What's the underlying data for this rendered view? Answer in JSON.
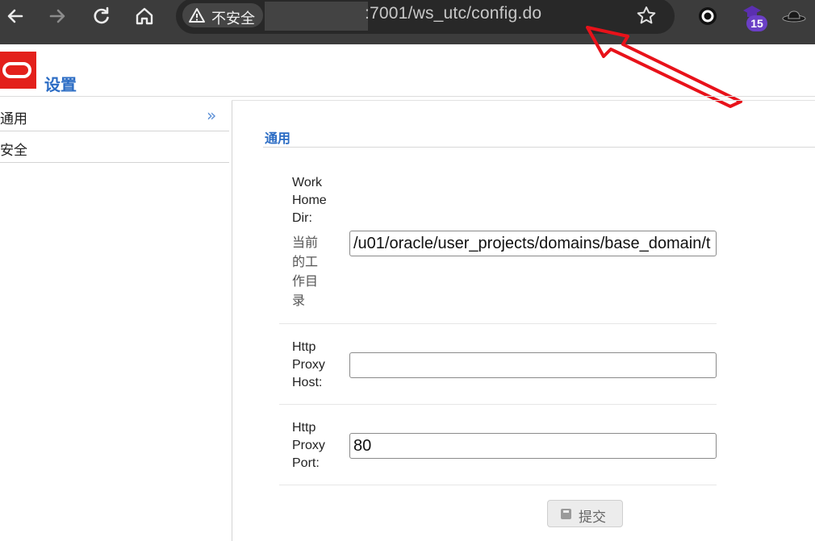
{
  "browser": {
    "security_label": "不安全",
    "url": ":7001/ws_utc/config.do",
    "extension_badge": "15"
  },
  "page": {
    "title": "设置"
  },
  "sidebar": {
    "items": [
      {
        "label": "通用",
        "active": true
      },
      {
        "label": "安全",
        "active": false
      }
    ]
  },
  "main": {
    "section_title": "通用",
    "fields": [
      {
        "label": "Work Home Dir:",
        "help": "当前的工作目录",
        "value": "/u01/oracle/user_projects/domains/base_domain/t"
      },
      {
        "label": "Http Proxy Host:",
        "value": ""
      },
      {
        "label": "Http Proxy Port:",
        "value": "80"
      }
    ],
    "submit_label": "提交"
  },
  "colors": {
    "accent_blue": "#2b6cc4",
    "annotation_red": "#e8121a",
    "oracle_red": "#e3201b"
  }
}
